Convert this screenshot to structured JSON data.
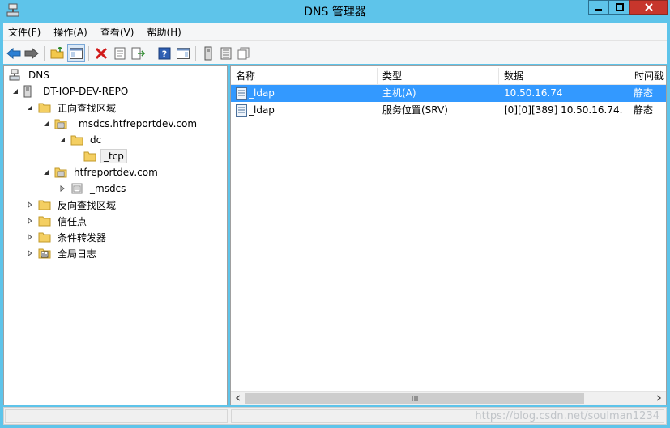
{
  "window": {
    "title": "DNS 管理器",
    "title_bar_color": "#5ec4ea",
    "close_button_color": "#c7362c"
  },
  "menu": [
    {
      "label": "文件(F)"
    },
    {
      "label": "操作(A)"
    },
    {
      "label": "查看(V)"
    },
    {
      "label": "帮助(H)"
    }
  ],
  "toolbar": [
    {
      "icon": "back-arrow-icon"
    },
    {
      "icon": "forward-arrow-icon"
    },
    {
      "icon": "up-folder-icon"
    },
    {
      "icon": "show-hide-tree-icon",
      "active": true
    },
    {
      "icon": "delete-icon"
    },
    {
      "icon": "properties-icon"
    },
    {
      "icon": "export-list-icon"
    },
    {
      "icon": "help-icon"
    },
    {
      "icon": "action-pane-icon"
    },
    {
      "icon": "server-icon"
    },
    {
      "icon": "zone-list-icon"
    },
    {
      "icon": "copy-records-icon"
    }
  ],
  "tree": [
    {
      "label": "DNS",
      "icon": "dns-root-icon",
      "expander": "none",
      "level": 0
    },
    {
      "label": "DT-IOP-DEV-REPO",
      "icon": "server-computer-icon",
      "expander": "expanded",
      "level": 1
    },
    {
      "label": "正向查找区域",
      "icon": "folder-icon",
      "expander": "expanded",
      "level": 2
    },
    {
      "label": "_msdcs.htfreportdev.com",
      "icon": "zone-icon",
      "expander": "expanded",
      "level": 3
    },
    {
      "label": "dc",
      "icon": "folder-icon",
      "expander": "expanded",
      "level": 4
    },
    {
      "label": "_tcp",
      "icon": "folder-icon",
      "expander": "none",
      "level": 5,
      "selected": true
    },
    {
      "label": "htfreportdev.com",
      "icon": "zone-icon",
      "expander": "expanded",
      "level": 3
    },
    {
      "label": "_msdcs",
      "icon": "delegated-zone-icon",
      "expander": "collapsed",
      "level": 4
    },
    {
      "label": "反向查找区域",
      "icon": "folder-icon",
      "expander": "collapsed",
      "level": 2
    },
    {
      "label": "信任点",
      "icon": "folder-icon",
      "expander": "collapsed",
      "level": 2
    },
    {
      "label": "条件转发器",
      "icon": "folder-icon",
      "expander": "collapsed",
      "level": 2
    },
    {
      "label": "全局日志",
      "icon": "event-log-icon",
      "expander": "collapsed",
      "level": 2
    }
  ],
  "list": {
    "columns": [
      "名称",
      "类型",
      "数据",
      "时间戳"
    ],
    "rows": [
      {
        "name": "_ldap",
        "type": "主机(A)",
        "data": "10.50.16.74",
        "timestamp": "静态",
        "selected": true
      },
      {
        "name": "_ldap",
        "type": "服务位置(SRV)",
        "data": "[0][0][389] 10.50.16.74.",
        "timestamp": "静态",
        "selected": false
      }
    ],
    "selection_color": "#3399ff"
  },
  "watermark": "https://blog.csdn.net/soulman1234"
}
